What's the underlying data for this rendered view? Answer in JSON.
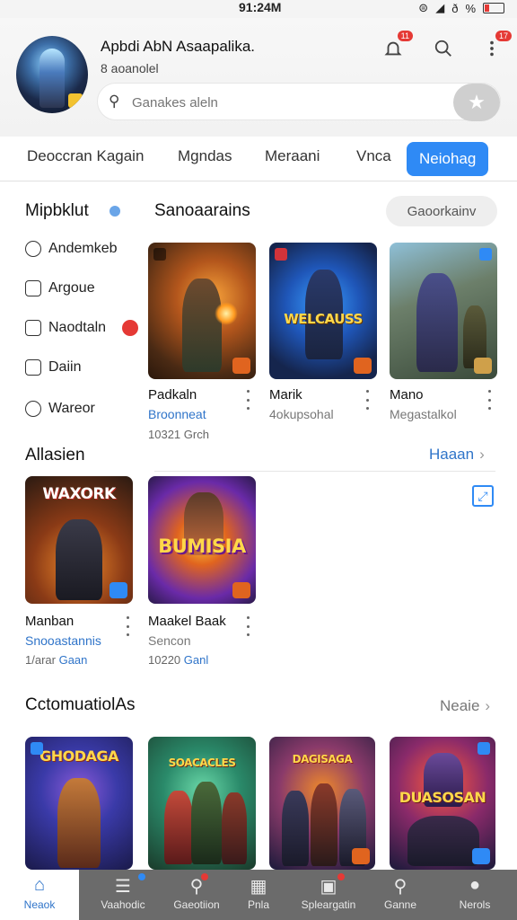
{
  "status": {
    "time": "91:24M",
    "battery_label": "%"
  },
  "header": {
    "user_name": "Apbdi AbN Asaapalika.",
    "user_sub": "8 aoanolel",
    "search_placeholder": "Ganakes aleln",
    "notif_badge": "11",
    "menu_badge": "17"
  },
  "tabs": [
    "Deoccran Kagain",
    "Mgndas",
    "Meraani",
    "Vnca",
    "Neiohag"
  ],
  "sidebar": {
    "title": "Mipbklut",
    "items": [
      "Andemkeb",
      "Argoue",
      "Naodtaln",
      "Daiin",
      "Wareor"
    ]
  },
  "section1": {
    "title": "Sanoaarains",
    "dropdown": "Gaoorkainv",
    "cards": [
      {
        "art": "",
        "title": "Padkaln",
        "sub": "Broonneat",
        "info": "10321 Grch"
      },
      {
        "art": "WELCAUSS",
        "title": "Marik",
        "sub": "4okupsohal",
        "info": ""
      },
      {
        "art": "",
        "title": "Mano",
        "sub": "Megastalkol",
        "info": ""
      }
    ]
  },
  "section2": {
    "title": "Allasien",
    "link": "Haaan",
    "cards": [
      {
        "art": "WAXORK",
        "title": "Manban",
        "sub": "Snooastannis",
        "info": "1/arar",
        "info_blue": "Gaan"
      },
      {
        "art": "BUMISIA",
        "title": "Maakel Baak",
        "sub": "Sencon",
        "info": "10220",
        "info_blue": "Ganl"
      }
    ]
  },
  "section3": {
    "title": "CctomuatiolAs",
    "link": "Neaie",
    "cards": [
      {
        "art": "GHODAGA"
      },
      {
        "art": "SOACACLES"
      },
      {
        "art": "DAGISAGA"
      },
      {
        "art": "DUASOSAN"
      }
    ]
  },
  "bottom_nav": [
    {
      "label": "Neaok",
      "icon": "home-icon"
    },
    {
      "label": "Vaahodic",
      "icon": "menu-icon"
    },
    {
      "label": "Gaeotiion",
      "icon": "search-icon"
    },
    {
      "label": "Pnla",
      "icon": "game-icon"
    },
    {
      "label": "Spleargatin",
      "icon": "store-icon"
    },
    {
      "label": "Ganne",
      "icon": "search-icon"
    },
    {
      "label": "Nerols",
      "icon": "profile-icon"
    }
  ],
  "colors": {
    "accent": "#2f8af5",
    "link": "#2f74c9",
    "badge": "#e53935",
    "nav_bg": "#6b6b6b"
  }
}
